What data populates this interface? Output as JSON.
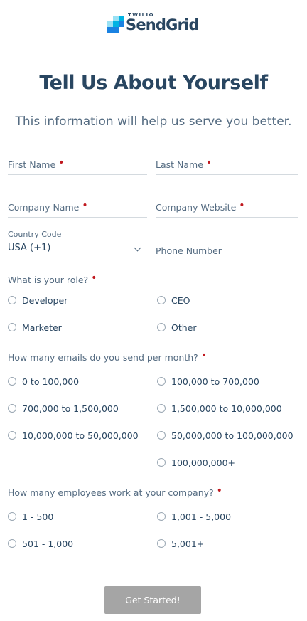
{
  "logo": {
    "company": "TWILIO",
    "product": "SendGrid"
  },
  "page_title": "Tell Us About Yourself",
  "subtitle": "This information will help us serve you better.",
  "required_marker": "•",
  "fields": {
    "first_name": "First Name",
    "last_name": "Last Name",
    "company_name": "Company Name",
    "company_website": "Company Website",
    "country_code_label": "Country Code",
    "country_code_value": "USA (+1)",
    "phone_number": "Phone Number"
  },
  "role": {
    "question": "What is your role?",
    "options": [
      "Developer",
      "CEO",
      "Marketer",
      "Other"
    ]
  },
  "emails": {
    "question": "How many emails do you send per month?",
    "options": [
      "0 to 100,000",
      "100,000 to 700,000",
      "700,000 to 1,500,000",
      "1,500,000 to 10,000,000",
      "10,000,000 to 50,000,000",
      "50,000,000 to 100,000,000",
      "100,000,000+"
    ]
  },
  "employees": {
    "question": "How many employees work at your company?",
    "options": [
      "1 - 500",
      "1,001 - 5,000",
      "501 - 1,000",
      "5,001+"
    ]
  },
  "submit_label": "Get Started!",
  "colors": {
    "heading": "#294661",
    "text": "#546b81",
    "required": "#c0191f",
    "button_disabled": "#a5a5a5",
    "logo_blue": "#1a82e2",
    "logo_light": "#99e1f4"
  }
}
